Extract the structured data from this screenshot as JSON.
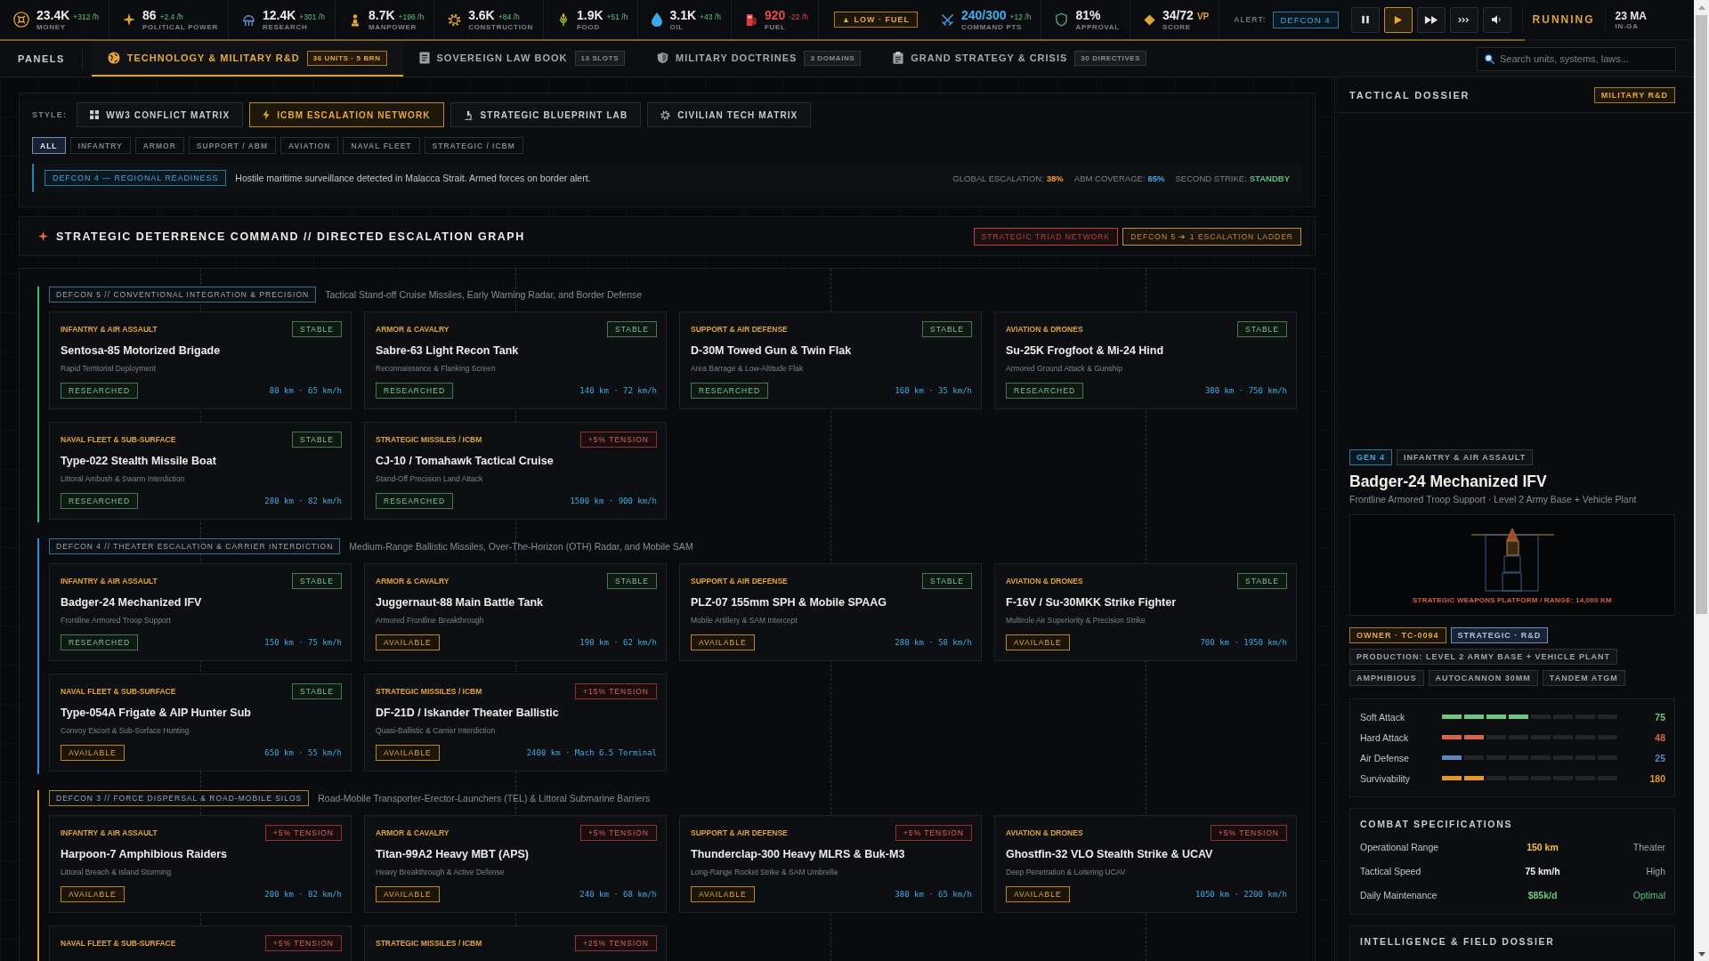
{
  "top_bar": {
    "resources": [
      {
        "kind": "money",
        "value": "23.4K",
        "delta": "+312 /h",
        "negative": false,
        "label": "MONEY",
        "color": "#ecebe7"
      },
      {
        "kind": "political",
        "value": "86",
        "delta": "+2.4 /h",
        "negative": false,
        "label": "POLITICAL POWER",
        "color": "#ecebe7"
      },
      {
        "kind": "research",
        "value": "12.4K",
        "delta": "+301 /h",
        "negative": false,
        "label": "RESEARCH",
        "color": "#ecebe7"
      },
      {
        "kind": "manpower",
        "value": "8.7K",
        "delta": "+196 /h",
        "negative": false,
        "label": "MANPOWER",
        "color": "#ecebe7"
      },
      {
        "kind": "construction",
        "value": "3.6K",
        "delta": "+84 /h",
        "negative": false,
        "label": "CONSTRUCTION",
        "color": "#ecebe7"
      },
      {
        "kind": "food",
        "value": "1.9K",
        "delta": "+51 /h",
        "negative": false,
        "label": "FOOD",
        "color": "#ecebe7"
      },
      {
        "kind": "oil",
        "value": "3.1K",
        "delta": "+43 /h",
        "negative": false,
        "label": "OIL",
        "color": "#ecebe7"
      },
      {
        "kind": "fuel",
        "value": "920",
        "delta": "-22 /h",
        "negative": true,
        "label": "FUEL",
        "color": "#e8484a"
      }
    ],
    "warning": "▲ LOW · FUEL",
    "indicators": [
      {
        "kind": "command",
        "value": "240/300",
        "delta": "+12 /h",
        "negative": false,
        "label": "COMMAND PTS",
        "color": "#3fb0f0"
      },
      {
        "kind": "approval",
        "value": "81%",
        "label": "APPROVAL",
        "color": "#ecebe7"
      },
      {
        "kind": "score",
        "value": "34/72",
        "unit": "VP",
        "label": "SCORE",
        "color": "#ecebe7"
      }
    ],
    "alert": {
      "label": "ALERT:",
      "value": "DEFCON 4"
    },
    "controls": [
      {
        "kind": "pause",
        "selected": false
      },
      {
        "kind": "play",
        "selected": true
      },
      {
        "kind": "fast",
        "selected": false
      },
      {
        "kind": "fastest",
        "selected": false
      },
      {
        "kind": "sound",
        "selected": false
      }
    ],
    "status": "RUNNING",
    "date": "23 MA",
    "date_label": "IN-GA",
    "turn_progress": {
      "level": 0.9
    }
  },
  "tab_bar": {
    "label": "PANELS",
    "tabs": [
      {
        "kind": "globe",
        "label": "TECHNOLOGY & MILITARY R&D",
        "badge": "36 UNITS · 5 BRN",
        "selected": true
      },
      {
        "kind": "document",
        "label": "SOVEREIGN LAW BOOK",
        "badge": "13 SLOTS",
        "selected": false
      },
      {
        "kind": "shield",
        "label": "MILITARY DOCTRINES",
        "badge": "3 DOMAINS",
        "selected": false
      },
      {
        "kind": "clipboard",
        "label": "GRAND STRATEGY & CRISIS",
        "badge": "30 DIRECTIVES",
        "selected": false
      }
    ],
    "search": {
      "placeholder": "Search units, systems, laws..."
    }
  },
  "style_panel": {
    "label": "STYLE:",
    "styles": [
      {
        "kind": "grid",
        "label": "WW3 CONFLICT MATRIX",
        "selected": false
      },
      {
        "kind": "bolt",
        "label": "ICBM ESCALATION NETWORK",
        "selected": true
      },
      {
        "kind": "flask",
        "label": "STRATEGIC BLUEPRINT LAB",
        "selected": false
      },
      {
        "kind": "gear",
        "label": "CIVILIAN TECH MATRIX",
        "selected": false
      }
    ],
    "filters": [
      {
        "label": "ALL",
        "selected": true
      },
      {
        "label": "INFANTRY",
        "selected": false
      },
      {
        "label": "ARMOR",
        "selected": false
      },
      {
        "label": "SUPPORT / ABM",
        "selected": false
      },
      {
        "label": "AVIATION",
        "selected": false
      },
      {
        "label": "NAVAL FLEET",
        "selected": false
      },
      {
        "label": "STRATEGIC / ICBM",
        "selected": false
      }
    ],
    "alert": {
      "badge": "DEFCON 4 — REGIONAL READINESS",
      "message": "Hostile maritime surveillance detected in Malacca Strait. Armed forces on border alert.",
      "metrics": [
        {
          "label": "GLOBAL ESCALATION:",
          "value": "38%",
          "color": "#f0a030"
        },
        {
          "label": "ABM COVERAGE:",
          "value": "65%",
          "color": "#4aa8e0"
        },
        {
          "label": "SECOND STRIKE:",
          "value": "STANDBY",
          "color": "#5cc080"
        }
      ]
    }
  },
  "command": {
    "title": "STRATEGIC DETERRENCE COMMAND // DIRECTED ESCALATION GRAPH",
    "badges": [
      {
        "label": "STRATEGIC TRIAD NETWORK",
        "color": "#c4403f"
      },
      {
        "label": "DEFCON 5 ➔ 1 ESCALATION LADDER",
        "color": "#d08a2a"
      }
    ]
  },
  "graph": {
    "tiers": [
      {
        "color": "#2ec27e",
        "badge": {
          "label": "DEFCON 5 // CONVENTIONAL INTEGRATION & PRECISION",
          "color": "#3a6f90"
        },
        "description": "Tactical Stand-off Cruise Missiles, Early Warning Radar, and Border Defense",
        "units": [
          {
            "category": "INFANTRY & AIR ASSAULT",
            "status": {
              "kind": "stable",
              "label": "STABLE"
            },
            "name": "Sentosa-85 Motorized Brigade",
            "role": "Rapid Territorial Deployment",
            "availability": {
              "kind": "researched",
              "label": "RESEARCHED"
            },
            "specs": "80 km · 65 km/h"
          },
          {
            "category": "ARMOR & CAVALRY",
            "status": {
              "kind": "stable",
              "label": "STABLE"
            },
            "name": "Sabre-63 Light Recon Tank",
            "role": "Reconnaissance & Flanking Screen",
            "availability": {
              "kind": "researched",
              "label": "RESEARCHED"
            },
            "specs": "140 km · 72 km/h"
          },
          {
            "category": "SUPPORT & AIR DEFENSE",
            "status": {
              "kind": "stable",
              "label": "STABLE"
            },
            "name": "D-30M Towed Gun & Twin Flak",
            "role": "Area Barrage & Low-Altitude Flak",
            "availability": {
              "kind": "researched",
              "label": "RESEARCHED"
            },
            "specs": "160 km · 35 km/h"
          },
          {
            "category": "AVIATION & DRONES",
            "status": {
              "kind": "stable",
              "label": "STABLE"
            },
            "name": "Su-25K Frogfoot & Mi-24 Hind",
            "role": "Armored Ground Attack & Gunship",
            "availability": {
              "kind": "researched",
              "label": "RESEARCHED"
            },
            "specs": "380 km · 750 km/h"
          },
          {
            "category": "NAVAL FLEET & SUB-SURFACE",
            "status": {
              "kind": "stable",
              "label": "STABLE"
            },
            "name": "Type-022 Stealth Missile Boat",
            "role": "Littoral Ambush & Swarm Interdiction",
            "availability": {
              "kind": "researched",
              "label": "RESEARCHED"
            },
            "specs": "280 km · 82 km/h"
          },
          {
            "category": "STRATEGIC MISSILES / ICBM",
            "status": {
              "kind": "tension",
              "label": "+5% TENSION"
            },
            "name": "CJ-10 / Tomahawk Tactical Cruise",
            "role": "Stand-Off Precision Land Attack",
            "availability": {
              "kind": "researched",
              "label": "RESEARCHED"
            },
            "specs": "1500 km · 900 km/h"
          }
        ]
      },
      {
        "color": "#2f8fd8",
        "badge": {
          "label": "DEFCON 4 // THEATER ESCALATION & CARRIER INTERDICTION",
          "color": "#3a6f90"
        },
        "description": "Medium-Range Ballistic Missiles, Over-The-Horizon (OTH) Radar, and Mobile SAM",
        "units": [
          {
            "category": "INFANTRY & AIR ASSAULT",
            "status": {
              "kind": "stable",
              "label": "STABLE"
            },
            "name": "Badger-24 Mechanized IFV",
            "role": "Frontline Armored Troop Support",
            "availability": {
              "kind": "researched",
              "label": "RESEARCHED"
            },
            "specs": "150 km · 75 km/h"
          },
          {
            "category": "ARMOR & CAVALRY",
            "status": {
              "kind": "stable",
              "label": "STABLE"
            },
            "name": "Juggernaut-88 Main Battle Tank",
            "role": "Armored Frontline Breakthrough",
            "availability": {
              "kind": "available",
              "label": "AVAILABLE"
            },
            "specs": "190 km · 62 km/h"
          },
          {
            "category": "SUPPORT & AIR DEFENSE",
            "status": {
              "kind": "stable",
              "label": "STABLE"
            },
            "name": "PLZ-07 155mm SPH & Mobile SPAAG",
            "role": "Mobile Artillery & SAM Intercept",
            "availability": {
              "kind": "available",
              "label": "AVAILABLE"
            },
            "specs": "280 km · 58 km/h"
          },
          {
            "category": "AVIATION & DRONES",
            "status": {
              "kind": "stable",
              "label": "STABLE"
            },
            "name": "F-16V / Su-30MKK Strike Fighter",
            "role": "Multirole Air Superiority & Precision Strike",
            "availability": {
              "kind": "available",
              "label": "AVAILABLE"
            },
            "specs": "700 km · 1950 km/h"
          },
          {
            "category": "NAVAL FLEET & SUB-SURFACE",
            "status": {
              "kind": "stable",
              "label": "STABLE"
            },
            "name": "Type-054A Frigate & AIP Hunter Sub",
            "role": "Convoy Escort & Sub-Surface Hunting",
            "availability": {
              "kind": "available",
              "label": "AVAILABLE"
            },
            "specs": "650 km · 55 km/h"
          },
          {
            "category": "STRATEGIC MISSILES / ICBM",
            "status": {
              "kind": "tension",
              "label": "+15% TENSION"
            },
            "name": "DF-21D / Iskander Theater Ballistic",
            "role": "Quasi-Ballistic & Carrier Interdiction",
            "availability": {
              "kind": "available",
              "label": "AVAILABLE"
            },
            "specs": "2400 km · Mach 6.5 Terminal"
          }
        ]
      },
      {
        "color": "#e0a43a",
        "badge": {
          "label": "DEFCON 3 // FORCE DISPERSAL & ROAD-MOBILE SILOS",
          "color": "#a9822e"
        },
        "description": "Road-Mobile Transporter-Erector-Launchers (TEL) & Littoral Submarine Barriers",
        "units": [
          {
            "category": "INFANTRY & AIR ASSAULT",
            "status": {
              "kind": "tension",
              "label": "+5% TENSION"
            },
            "name": "Harpoon-7 Amphibious Raiders",
            "role": "Littoral Breach & Island Storming",
            "availability": {
              "kind": "available",
              "label": "AVAILABLE"
            },
            "specs": "200 km · 82 km/h"
          },
          {
            "category": "ARMOR & CAVALRY",
            "status": {
              "kind": "tension",
              "label": "+5% TENSION"
            },
            "name": "Titan-99A2 Heavy MBT (APS)",
            "role": "Heavy Breakthrough & Active Defense",
            "availability": {
              "kind": "available",
              "label": "AVAILABLE"
            },
            "specs": "240 km · 68 km/h"
          },
          {
            "category": "SUPPORT & AIR DEFENSE",
            "status": {
              "kind": "tension",
              "label": "+5% TENSION"
            },
            "name": "Thunderclap-300 Heavy MLRS & Buk-M3",
            "role": "Long-Range Rocket Strike & SAM Umbrella",
            "availability": {
              "kind": "available",
              "label": "AVAILABLE"
            },
            "specs": "380 km · 65 km/h"
          },
          {
            "category": "AVIATION & DRONES",
            "status": {
              "kind": "tension",
              "label": "+5% TENSION"
            },
            "name": "Ghostfin-32 VLO Stealth Strike & UCAV",
            "role": "Deep Penetration & Loitering UCAV",
            "availability": {
              "kind": "available",
              "label": "AVAILABLE"
            },
            "specs": "1050 km · 2200 km/h"
          },
          {
            "category": "NAVAL FLEET & SUB-SURFACE",
            "status": {
              "kind": "tension",
              "label": "+5% TENSION"
            }
          },
          {
            "category": "STRATEGIC MISSILES / ICBM",
            "status": {
              "kind": "tension",
              "label": "+25% TENSION"
            }
          }
        ]
      }
    ]
  },
  "dossier": {
    "title": "TACTICAL DOSSIER",
    "badge": "MILITARY R&D",
    "tags": [
      {
        "kind": "generation",
        "label": "GEN 4"
      },
      {
        "kind": "category",
        "label": "INFANTRY & AIR ASSAULT"
      }
    ],
    "name": "Badger-24 Mechanized IFV",
    "subtitle": "Frontline Armored Troop Support · Level 2 Army Base + Vehicle Plant",
    "schematic": {
      "caption": "STRATEGIC WEAPONS PLATFORM / RANGE: 14,000 KM"
    },
    "chips": [
      {
        "kind": "owner",
        "label": "OWNER · TC-0094"
      },
      {
        "kind": "strategic",
        "label": "STRATEGIC · R&D"
      },
      {
        "kind": "plain",
        "label": "PRODUCTION: LEVEL 2 ARMY BASE + VEHICLE PLANT"
      },
      {
        "kind": "plain",
        "label": "AMPHIBIOUS"
      },
      {
        "kind": "plain",
        "label": "AUTOCANNON 30MM"
      },
      {
        "kind": "plain",
        "label": "TANDEM ATGM"
      }
    ],
    "ratings": [
      {
        "label": "Soft Attack",
        "level": 0.5,
        "value": "75",
        "color": "#6cc784"
      },
      {
        "label": "Hard Attack",
        "level": 0.25,
        "value": "48",
        "color": "#d8644c"
      },
      {
        "label": "Air Defense",
        "level": 0.125,
        "value": "25",
        "color": "#5a88bc"
      },
      {
        "label": "Survivability",
        "level": 0.25,
        "value": "180",
        "color": "#e2972c"
      }
    ],
    "specs": {
      "title": "COMBAT SPECIFICATIONS",
      "rows": [
        {
          "label": "Operational Range",
          "value": "150 km",
          "rating": "Theater",
          "color": "#f2c04a",
          "positive": false
        },
        {
          "label": "Tactical Speed",
          "value": "75 km/h",
          "rating": "High",
          "color": "#f2f2f2",
          "positive": false
        },
        {
          "label": "Daily Maintenance",
          "value": "$85k/d",
          "rating": "Optimal",
          "color": "#6cc784",
          "positive": true
        }
      ]
    },
    "intel": {
      "title": "INTELLIGENCE & FIELD DOSSIER"
    }
  }
}
